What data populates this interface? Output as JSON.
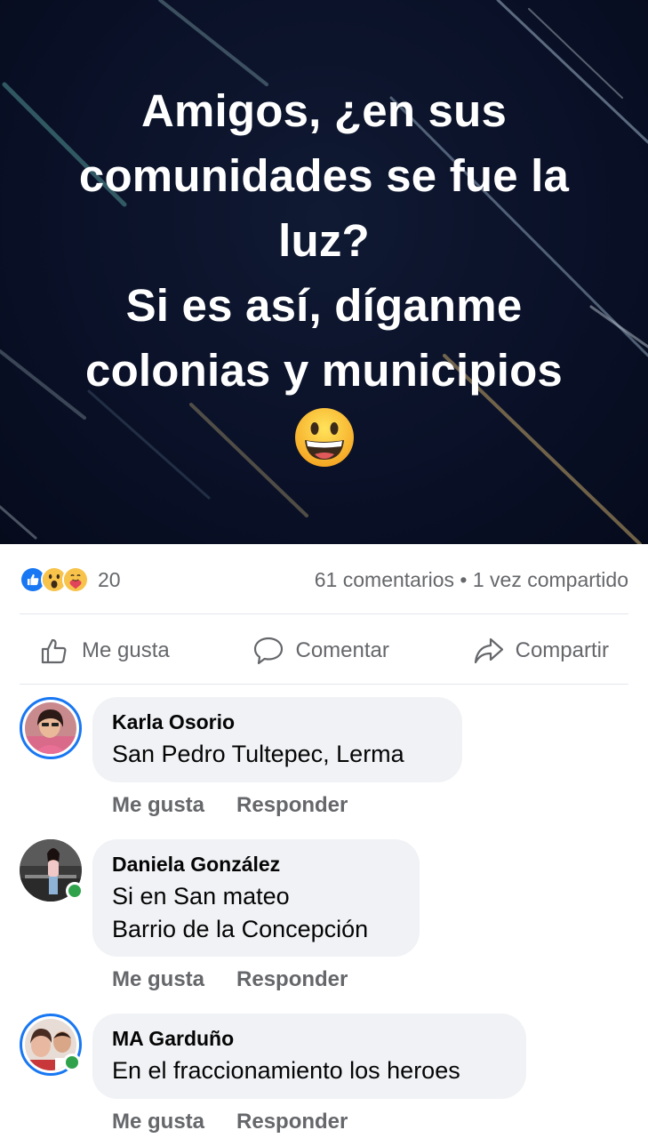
{
  "post": {
    "lines": [
      "Amigos, ¿en sus",
      "comunidades se fue la",
      "luz?",
      "Si es así, díganme",
      "colonias y municipios"
    ],
    "emoji": "grinning-face-icon",
    "background_color": "#0a1128"
  },
  "stats": {
    "reaction_icons": [
      "like-icon",
      "wow-icon",
      "care-icon"
    ],
    "reaction_count": "20",
    "comments": "61 comentarios • 1 vez compartido"
  },
  "actions": {
    "like": "Me gusta",
    "comment": "Comentar",
    "share": "Compartir"
  },
  "comments": [
    {
      "name": "Karla Osorio",
      "lines": [
        "San Pedro Tultepec, Lerma"
      ],
      "like": "Me gusta",
      "reply": "Responder"
    },
    {
      "name": "Daniela González",
      "lines": [
        "Si en San mateo",
        "Barrio de la Concepción"
      ],
      "like": "Me gusta",
      "reply": "Responder"
    },
    {
      "name": "MA Garduño",
      "lines": [
        "En el fraccionamiento los heroes"
      ],
      "like": "Me gusta",
      "reply": "Responder"
    }
  ],
  "colors": {
    "accent": "#1877f2",
    "online": "#31a24c",
    "muted": "#65676b",
    "bubble": "#f0f2f5"
  }
}
